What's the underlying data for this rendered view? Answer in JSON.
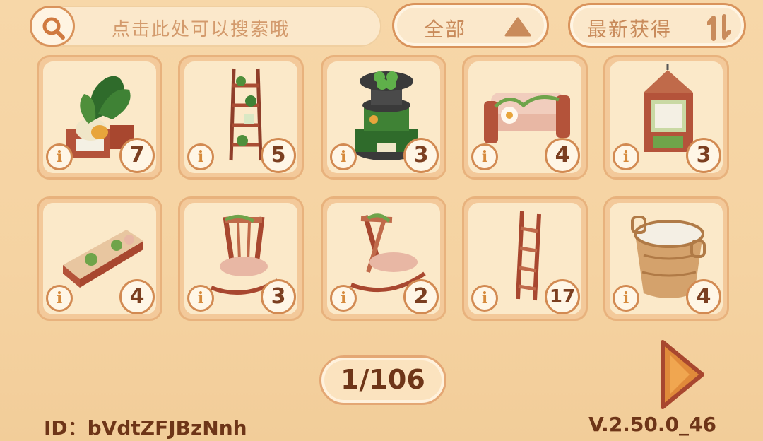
{
  "search": {
    "placeholder": "点击此处可以搜索哦"
  },
  "filter": {
    "label": "全部"
  },
  "sort": {
    "label": "最新获得"
  },
  "items": [
    {
      "name": "monstera-planter-icon",
      "count": "7"
    },
    {
      "name": "wooden-shelf-plants-icon",
      "count": "5"
    },
    {
      "name": "clover-tiered-stand-icon",
      "count": "3"
    },
    {
      "name": "vine-log-sofa-icon",
      "count": "4"
    },
    {
      "name": "vine-wooden-cabinet-icon",
      "count": "3"
    },
    {
      "name": "log-bench-icon",
      "count": "4"
    },
    {
      "name": "rocking-chair-icon",
      "count": "3"
    },
    {
      "name": "rocking-chair-side-icon",
      "count": "2"
    },
    {
      "name": "wooden-ladder-icon",
      "count": "17"
    },
    {
      "name": "woven-basket-icon",
      "count": "4"
    }
  ],
  "info_glyph": "i",
  "pager": {
    "text": "1/106"
  },
  "footer": {
    "id": "ID：bVdtZFJBzNnh",
    "version": "V.2.50.0_46"
  },
  "colors": {
    "accent": "#d9935b",
    "text_dark": "#6e3518",
    "card_bg": "#fbe9c9"
  }
}
